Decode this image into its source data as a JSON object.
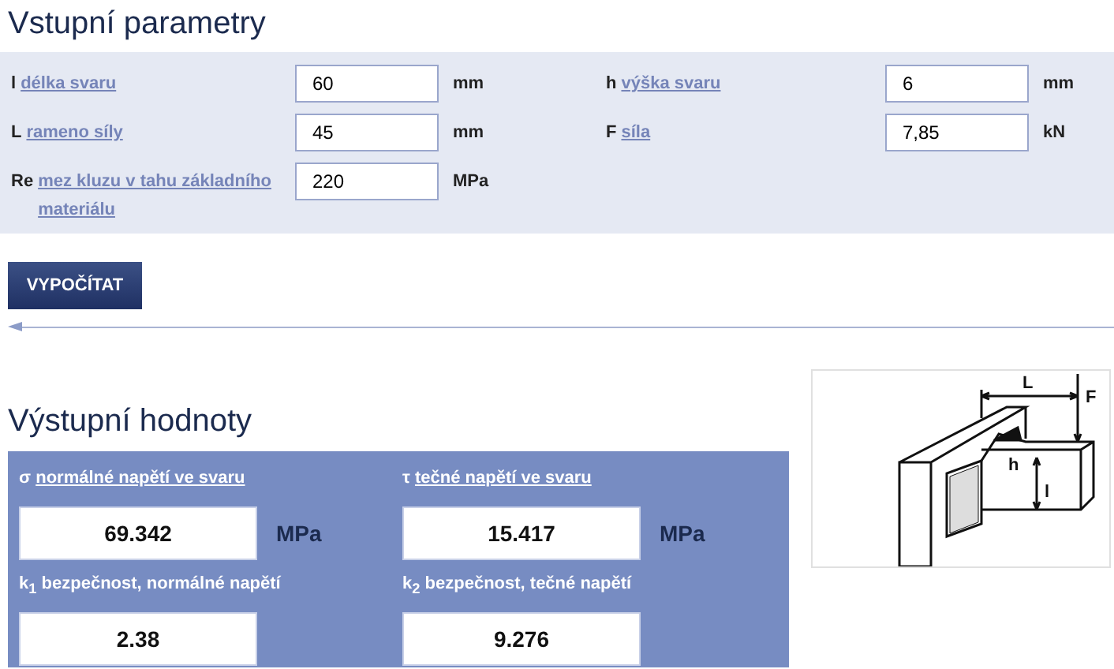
{
  "input_section": {
    "title": "Vstupní parametry",
    "fields": [
      {
        "symbol": "l",
        "label": "délka svaru",
        "value": "60",
        "unit": "mm"
      },
      {
        "symbol": "h",
        "label": "výška svaru",
        "value": "6",
        "unit": "mm"
      },
      {
        "symbol": "L",
        "label": "rameno síly",
        "value": "45",
        "unit": "mm"
      },
      {
        "symbol": "F",
        "label": "síla",
        "value": "7,85",
        "unit": "kN"
      },
      {
        "symbol": "Re",
        "label": "mez kluzu v tahu základního materiálu",
        "value": "220",
        "unit": "MPa"
      }
    ]
  },
  "calculate_button": "VYPOČÍTAT",
  "output_section": {
    "title": "Výstupní hodnoty",
    "results": [
      {
        "symbol": "σ",
        "label": "normálné napětí ve svaru",
        "linked": true,
        "value": "69.342",
        "unit": "MPa"
      },
      {
        "symbol": "τ",
        "label": "tečné napětí ve svaru",
        "linked": true,
        "value": "15.417",
        "unit": "MPa"
      },
      {
        "symbol": "k$_{1}$",
        "label": "bezpečnost, normálné napětí",
        "linked": false,
        "value": "2.38"
      },
      {
        "symbol": "k$_{2}$",
        "label": "bezpečnost, tečné napětí",
        "linked": false,
        "value": "9.276"
      }
    ]
  },
  "diagram": {
    "labels": [
      "L",
      "F",
      "h",
      "l"
    ]
  }
}
